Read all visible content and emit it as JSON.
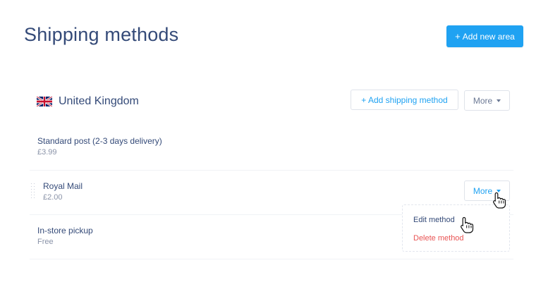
{
  "page": {
    "title": "Shipping methods"
  },
  "header": {
    "add_area_label": "Add new area",
    "add_area_icon": "plus-icon"
  },
  "area": {
    "country": "United Kingdom",
    "flag_icon": "uk-flag-icon",
    "add_method_label": "+ Add shipping method",
    "more_label": "More"
  },
  "methods": [
    {
      "name": "Standard post (2-3 days delivery)",
      "price": "£3.99"
    },
    {
      "name": "Royal Mail",
      "price": "£2.00",
      "more_label": "More"
    },
    {
      "name": "In-store pickup",
      "price": "Free"
    }
  ],
  "dropdown": {
    "items": [
      {
        "label": "Edit method"
      },
      {
        "label": "Delete method"
      }
    ]
  },
  "colors": {
    "primary": "#1fa2f2",
    "danger": "#e95454",
    "heading": "#344a78"
  }
}
